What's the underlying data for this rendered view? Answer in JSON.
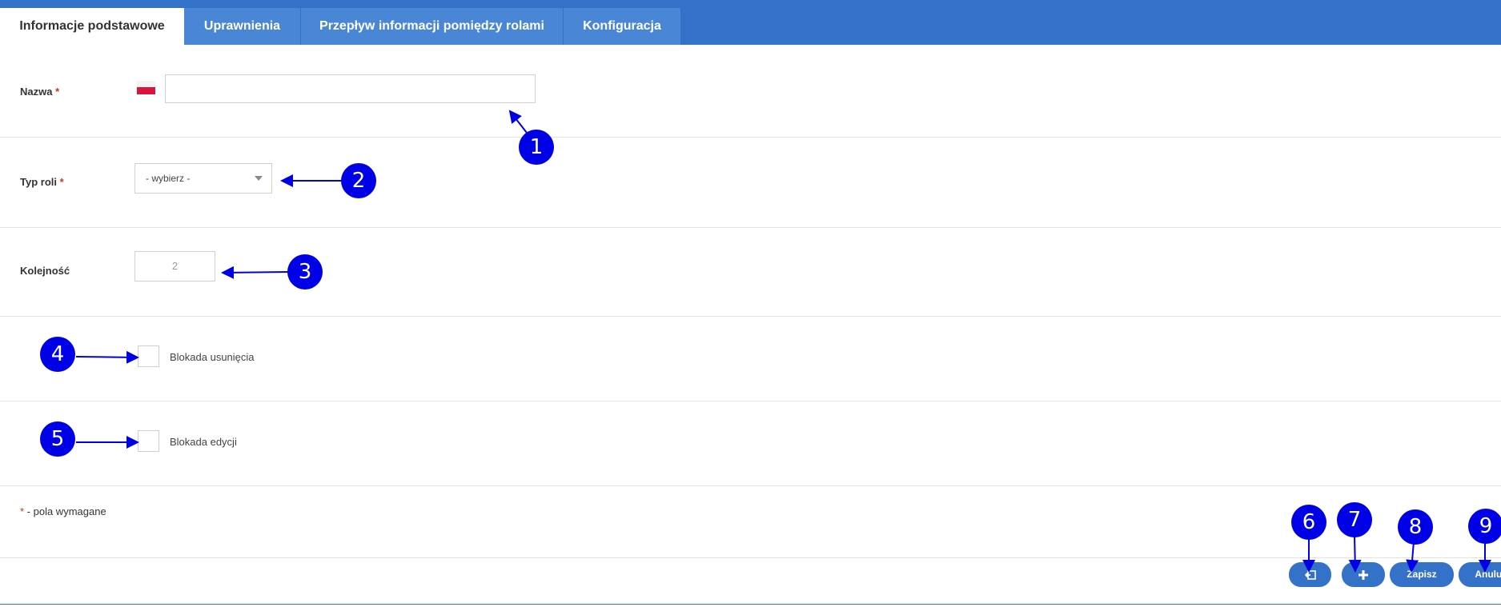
{
  "tabs": [
    {
      "label": "Informacje podstawowe",
      "active": true
    },
    {
      "label": "Uprawnienia",
      "active": false
    },
    {
      "label": "Przepływ informacji pomiędzy rolami",
      "active": false
    },
    {
      "label": "Konfiguracja",
      "active": false
    }
  ],
  "form": {
    "name": {
      "label": "Nazwa",
      "required_mark": "*",
      "value": "",
      "flag": "pl-flag-icon"
    },
    "role_type": {
      "label": "Typ roli",
      "required_mark": "*",
      "selected": "- wybierz -"
    },
    "order": {
      "label": "Kolejność",
      "value": "2"
    },
    "delete_lock": {
      "label": "Blokada usunięcia",
      "checked": false
    },
    "edit_lock": {
      "label": "Blokada edycji",
      "checked": false
    },
    "required_note": {
      "mark": "*",
      "text": " - pola wymagane"
    }
  },
  "buttons": {
    "back_icon": "back-arrow-icon",
    "add_icon": "plus-icon",
    "save_label": "Zapisz",
    "cancel_label": "Anuluj"
  },
  "callouts": [
    "1",
    "2",
    "3",
    "4",
    "5",
    "6",
    "7",
    "8",
    "9"
  ],
  "colors": {
    "header": "#3472c9",
    "tab_inactive": "#4a86d6",
    "button": "#3472c9",
    "callout": "#0000e6",
    "required": "#c0392b"
  }
}
